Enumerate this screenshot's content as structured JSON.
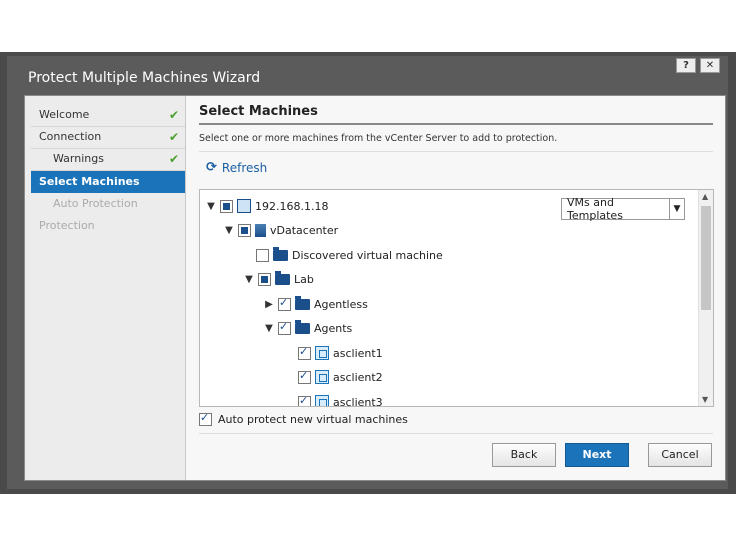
{
  "window": {
    "title": "Protect Multiple Machines Wizard",
    "help_label": "?",
    "close_label": "✕"
  },
  "nav": {
    "items": [
      {
        "label": "Welcome",
        "done": "✔"
      },
      {
        "label": "Connection",
        "done": "✔"
      },
      {
        "label": "Warnings",
        "done": "✔"
      },
      {
        "label": "Select Machines"
      },
      {
        "label": "Auto Protection"
      },
      {
        "label": "Protection"
      }
    ]
  },
  "content": {
    "heading": "Select Machines",
    "description": "Select one or more machines from the vCenter Server to add to protection.",
    "refresh_label": "Refresh",
    "view_select": {
      "value": "VMs and Templates",
      "options": [
        "VMs and Templates"
      ]
    },
    "tree": {
      "host": "192.168.1.18",
      "datacenter": "vDatacenter",
      "discovered": "Discovered virtual machine",
      "lab": "Lab",
      "agentless": "Agentless",
      "agents": "Agents",
      "vms": [
        "asclient1",
        "asclient2",
        "asclient3"
      ]
    },
    "auto_protect_label": "Auto protect new virtual machines",
    "buttons": {
      "back": "Back",
      "next": "Next",
      "cancel": "Cancel"
    }
  },
  "colors": {
    "accent": "#1b73b9",
    "check": "#4aa02c",
    "folder": "#1b4f8c"
  }
}
